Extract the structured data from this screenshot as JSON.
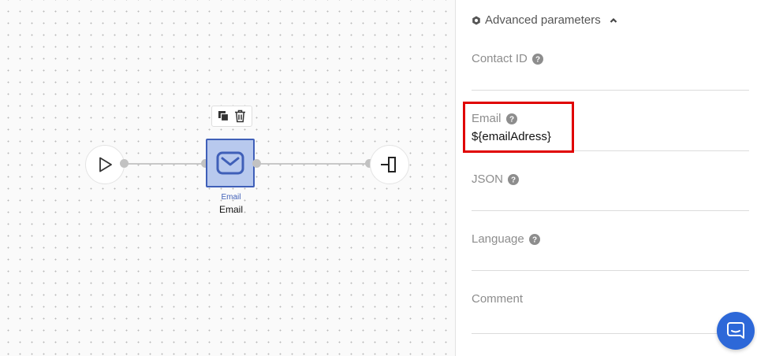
{
  "canvas": {
    "email_node": {
      "type_label": "Email",
      "name": "Email"
    }
  },
  "panel": {
    "advanced_header": "Advanced parameters",
    "fields": {
      "contact_id": {
        "label": "Contact ID",
        "value": ""
      },
      "email": {
        "label": "Email",
        "value": "${emailAdress}"
      },
      "json": {
        "label": "JSON",
        "value": ""
      },
      "language": {
        "label": "Language",
        "value": ""
      },
      "comment": {
        "label": "Comment",
        "value": ""
      }
    }
  },
  "icons": {
    "start": "play-icon",
    "end": "end-icon",
    "email": "envelope-icon",
    "copy": "copy-icon",
    "delete": "trash-icon",
    "gear": "gear-icon",
    "collapse": "chevron-up-icon",
    "help": "help-icon",
    "chat": "chat-icon"
  },
  "colors": {
    "node_fill": "#b8c9ee",
    "node_border": "#3f5fb8",
    "highlight": "#e00000",
    "chat_button": "#2d68d8"
  }
}
